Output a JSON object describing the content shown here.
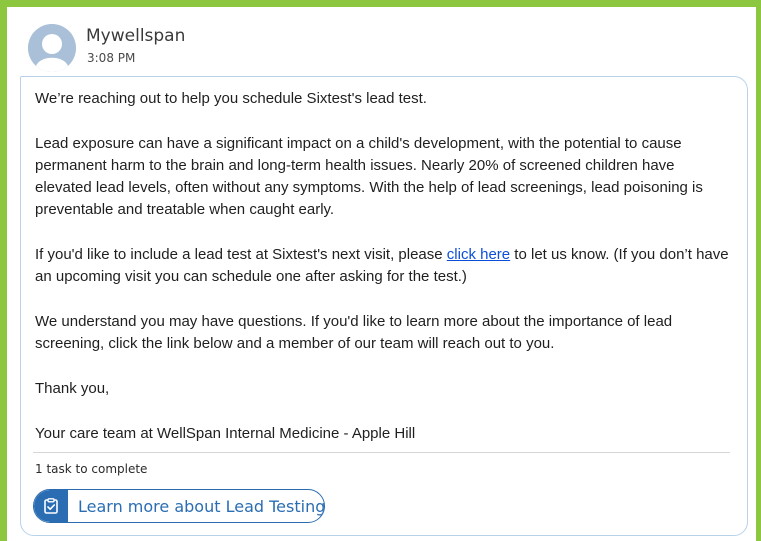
{
  "message": {
    "sender": "Mywellspan",
    "time": "3:08 PM",
    "paragraphs": {
      "p1": "We’re reaching out to help you schedule Sixtest's lead test.",
      "p2": "Lead exposure can have a significant impact on a child's development, with the potential to cause permanent harm to the brain and long-term health issues. Nearly 20% of screened children have elevated lead levels, often without any symptoms. With the help of lead screenings, lead poisoning is preventable and treatable when caught early.",
      "p3_before": "If you'd like to include a lead test at Sixtest's next visit, please ",
      "p3_link": "click here",
      "p3_after": " to let us know. (If you don’t have an upcoming visit you can schedule one after asking for the test.)",
      "p4": "We understand you may have questions. If you'd like to learn more about the importance of lead screening, click the link below and a member of our team will reach out to you.",
      "p5": "Thank you,",
      "p6": "Your care team at WellSpan Internal Medicine - Apple Hill"
    }
  },
  "tasks": {
    "summary": "1 task to complete",
    "button_label": "Learn more about Lead Testing",
    "icon": "clipboard-check-icon"
  },
  "colors": {
    "accent_green": "#8dc63f",
    "link_blue": "#0b4fd8",
    "task_blue": "#2a6db3"
  }
}
